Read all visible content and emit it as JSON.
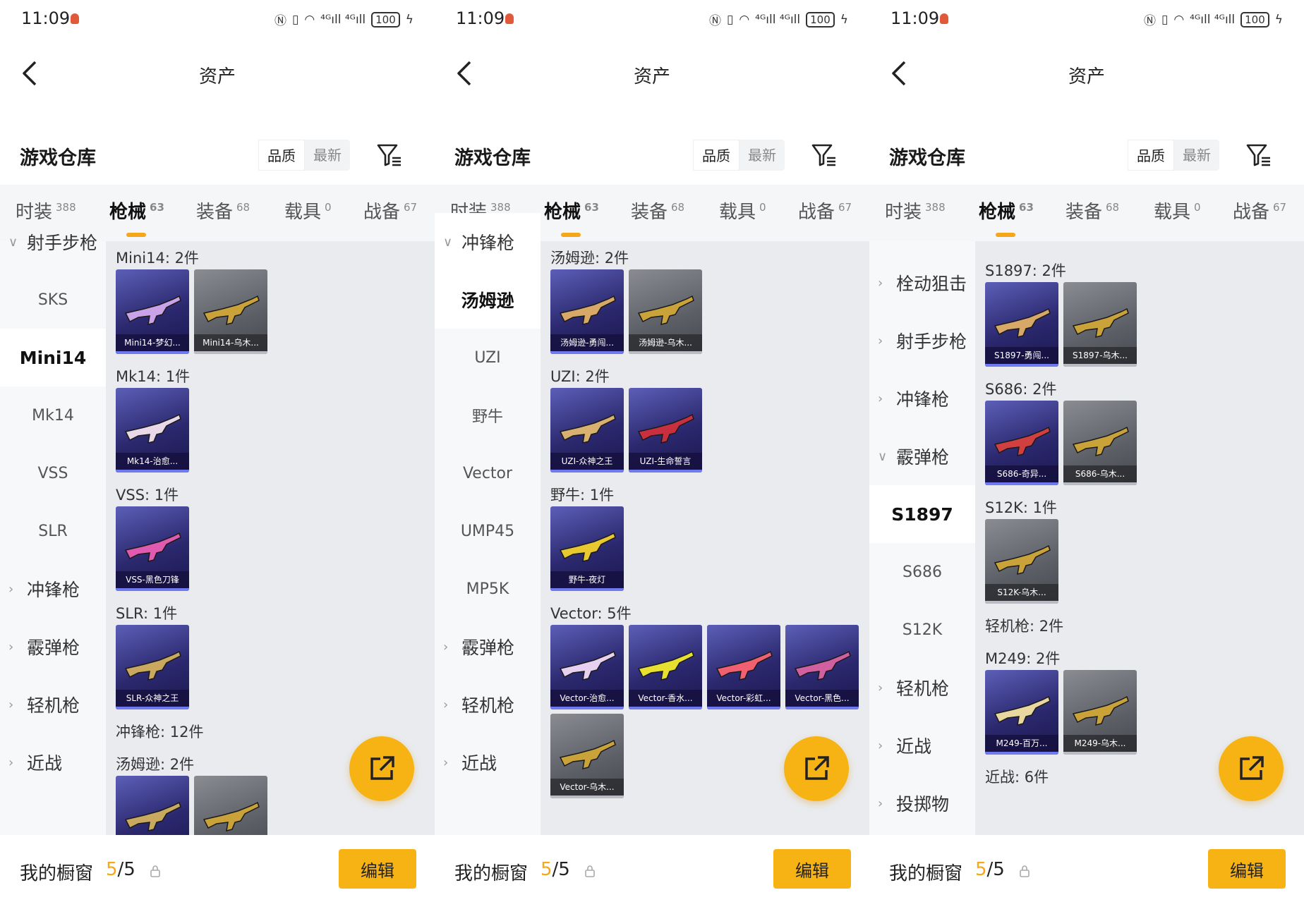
{
  "status": {
    "time": "11:09",
    "battery": "100",
    "signal": "⁴ᴳıll ⁴ᴳıll"
  },
  "navbar": {
    "title": "资产"
  },
  "warehouse": {
    "title": "游戏仓库",
    "sort_quality": "品质",
    "sort_latest": "最新"
  },
  "tabs": [
    {
      "label": "时装",
      "count": "388"
    },
    {
      "label": "枪械",
      "count": "63"
    },
    {
      "label": "装备",
      "count": "68"
    },
    {
      "label": "载具",
      "count": "0"
    },
    {
      "label": "战备",
      "count": "67"
    }
  ],
  "bottom": {
    "label": "我的橱窗",
    "count_used": "5",
    "count_total": "/5",
    "edit_label": "编辑"
  },
  "screens": [
    {
      "sidebar": [
        {
          "label": "射手步枪",
          "kind": "group-open"
        },
        {
          "label": "SKS",
          "kind": "item"
        },
        {
          "label": "Mini14",
          "kind": "item-selected"
        },
        {
          "label": "Mk14",
          "kind": "item"
        },
        {
          "label": "VSS",
          "kind": "item"
        },
        {
          "label": "SLR",
          "kind": "item"
        },
        {
          "label": "冲锋枪",
          "kind": "group"
        },
        {
          "label": "霰弹枪",
          "kind": "group"
        },
        {
          "label": "轻机枪",
          "kind": "group"
        },
        {
          "label": "近战",
          "kind": "group"
        }
      ],
      "sections": [
        {
          "title": "Mini14: 2件",
          "items": [
            {
              "name": "Mini14-梦幻...",
              "tier": "purple",
              "color": "#c9a2e8"
            },
            {
              "name": "Mini14-乌木...",
              "tier": "gray",
              "color": "#c9a33a"
            }
          ]
        },
        {
          "title": "Mk14: 1件",
          "items": [
            {
              "name": "Mk14-治愈...",
              "tier": "purple",
              "color": "#e8d8e8"
            }
          ]
        },
        {
          "title": "VSS: 1件",
          "items": [
            {
              "name": "VSS-黑色刀锋",
              "tier": "purple",
              "color": "#e05ab0"
            }
          ]
        },
        {
          "title": "SLR: 1件",
          "items": [
            {
              "name": "SLR-众神之王",
              "tier": "purple",
              "color": "#c9a860"
            }
          ]
        },
        {
          "title": "冲锋枪: 12件",
          "items": []
        },
        {
          "title": "汤姆逊: 2件",
          "items": [
            {
              "name": "",
              "tier": "purple",
              "color": "#c9a860"
            },
            {
              "name": "",
              "tier": "gray",
              "color": "#c9a33a"
            }
          ]
        }
      ]
    },
    {
      "sidebar": [
        {
          "label": "冲锋枪",
          "kind": "group-open"
        },
        {
          "label": "汤姆逊",
          "kind": "item-selected"
        },
        {
          "label": "UZI",
          "kind": "item"
        },
        {
          "label": "野牛",
          "kind": "item"
        },
        {
          "label": "Vector",
          "kind": "item"
        },
        {
          "label": "UMP45",
          "kind": "item"
        },
        {
          "label": "MP5K",
          "kind": "item"
        },
        {
          "label": "霰弹枪",
          "kind": "group"
        },
        {
          "label": "轻机枪",
          "kind": "group"
        },
        {
          "label": "近战",
          "kind": "group"
        }
      ],
      "sections": [
        {
          "title": "汤姆逊: 2件",
          "items": [
            {
              "name": "汤姆逊-勇闯...",
              "tier": "purple",
              "color": "#d8a868"
            },
            {
              "name": "汤姆逊-乌木...",
              "tier": "gray",
              "color": "#c9a33a"
            }
          ]
        },
        {
          "title": "UZI: 2件",
          "items": [
            {
              "name": "UZI-众神之王",
              "tier": "purple",
              "color": "#d8b070"
            },
            {
              "name": "UZI-生命誓言",
              "tier": "purple",
              "color": "#c83040"
            }
          ]
        },
        {
          "title": "野牛: 1件",
          "items": [
            {
              "name": "野牛-夜灯",
              "tier": "purple",
              "color": "#e8c830"
            }
          ]
        },
        {
          "title": "Vector: 5件",
          "items": [
            {
              "name": "Vector-治愈...",
              "tier": "purple",
              "color": "#e8d0f0"
            },
            {
              "name": "Vector-香水...",
              "tier": "purple",
              "color": "#e8e030"
            },
            {
              "name": "Vector-彩虹...",
              "tier": "purple",
              "color": "#f06070"
            },
            {
              "name": "Vector-黑色...",
              "tier": "purple",
              "color": "#d060a0"
            },
            {
              "name": "Vector-乌木...",
              "tier": "gray",
              "color": "#c9a33a"
            }
          ]
        }
      ]
    },
    {
      "sidebar": [
        {
          "label": "栓动狙击",
          "kind": "group"
        },
        {
          "label": "射手步枪",
          "kind": "group"
        },
        {
          "label": "冲锋枪",
          "kind": "group"
        },
        {
          "label": "霰弹枪",
          "kind": "group-open"
        },
        {
          "label": "S1897",
          "kind": "item-selected"
        },
        {
          "label": "S686",
          "kind": "item"
        },
        {
          "label": "S12K",
          "kind": "item"
        },
        {
          "label": "轻机枪",
          "kind": "group"
        },
        {
          "label": "近战",
          "kind": "group"
        },
        {
          "label": "投掷物",
          "kind": "group"
        }
      ],
      "sections": [
        {
          "title": "S1897: 2件",
          "items": [
            {
              "name": "S1897-勇闯...",
              "tier": "purple",
              "color": "#d8a868"
            },
            {
              "name": "S1897-乌木...",
              "tier": "gray",
              "color": "#c9a33a"
            }
          ]
        },
        {
          "title": "S686: 2件",
          "items": [
            {
              "name": "S686-奇异...",
              "tier": "purple",
              "color": "#d04040"
            },
            {
              "name": "S686-乌木...",
              "tier": "gray",
              "color": "#c9a33a"
            }
          ]
        },
        {
          "title": "S12K: 1件",
          "items": [
            {
              "name": "S12K-乌木...",
              "tier": "gray",
              "color": "#c9a33a"
            }
          ]
        },
        {
          "title": "轻机枪: 2件",
          "items": []
        },
        {
          "title": "M249: 2件",
          "items": [
            {
              "name": "M249-百万...",
              "tier": "purple",
              "color": "#e8d8a0"
            },
            {
              "name": "M249-乌木...",
              "tier": "gray",
              "color": "#c9a33a"
            }
          ]
        },
        {
          "title": "近战: 6件",
          "items": []
        }
      ]
    }
  ]
}
